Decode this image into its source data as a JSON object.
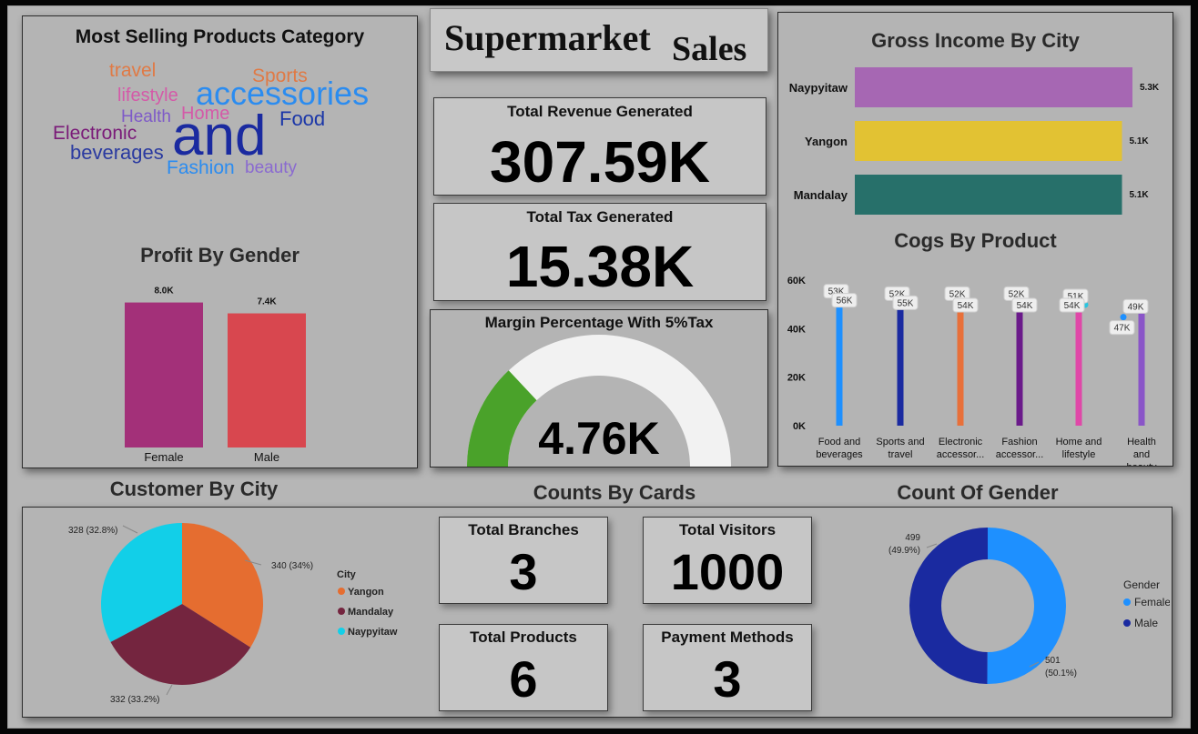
{
  "header": {
    "title_main": "Supermarket",
    "title_sub": "Sales"
  },
  "word_cloud": {
    "title": "Most Selling Products Category",
    "words": [
      {
        "text": "travel",
        "color": "#e07a45"
      },
      {
        "text": "Sports",
        "color": "#e07a45"
      },
      {
        "text": "lifestyle",
        "color": "#d45aa8"
      },
      {
        "text": "accessories",
        "color": "#2b8cf0"
      },
      {
        "text": "Health",
        "color": "#7e5ac8"
      },
      {
        "text": "Home",
        "color": "#d45aa8"
      },
      {
        "text": "Food",
        "color": "#1a36a8"
      },
      {
        "text": "Electronic",
        "color": "#7a1a78"
      },
      {
        "text": "and",
        "color": "#1a2aa0"
      },
      {
        "text": "beverages",
        "color": "#2a3aa0"
      },
      {
        "text": "Fashion",
        "color": "#2b8cf0"
      },
      {
        "text": "beauty",
        "color": "#8a6ad0"
      }
    ]
  },
  "kpis": {
    "revenue": {
      "label": "Total Revenue Generated",
      "value": "307.59K"
    },
    "tax": {
      "label": "Total Tax Generated",
      "value": "15.38K"
    },
    "margin": {
      "label": "Margin Percentage With 5%Tax",
      "value": "4.76K",
      "gauge_fraction": 0.26
    }
  },
  "counts": {
    "title": "Counts By Cards",
    "branches": {
      "label": "Total Branches",
      "value": "3"
    },
    "visitors": {
      "label": "Total Visitors",
      "value": "1000"
    },
    "products": {
      "label": "Total Products",
      "value": "6"
    },
    "payments": {
      "label": "Payment Methods",
      "value": "3"
    }
  },
  "chart_data": [
    {
      "type": "bar",
      "title": "Profit By Gender",
      "categories": [
        "Female",
        "Male"
      ],
      "values": [
        8.0,
        7.4
      ],
      "value_labels": [
        "8.0K",
        "7.4K"
      ],
      "colors": [
        "#a33079",
        "#d8474f"
      ],
      "ylim": [
        0,
        9
      ]
    },
    {
      "type": "bar",
      "title": "Gross Income By City",
      "orientation": "horizontal",
      "categories": [
        "Naypyitaw",
        "Yangon",
        "Mandalay"
      ],
      "values": [
        5.3,
        5.1,
        5.1
      ],
      "value_labels": [
        "5.3K",
        "5.1K",
        "5.1K"
      ],
      "colors": [
        "#a667b3",
        "#e2c233",
        "#27706a"
      ]
    },
    {
      "type": "bar",
      "title": "Cogs By Product",
      "categories": [
        "Food and beverages",
        "Sports and travel",
        "Electronic accessor...",
        "Fashion accessor...",
        "Home and lifestyle",
        "Health and beauty"
      ],
      "category_lines": [
        [
          "Food and",
          "beverages"
        ],
        [
          "Sports and",
          "travel"
        ],
        [
          "Electronic",
          "accessor..."
        ],
        [
          "Fashion",
          "accessor..."
        ],
        [
          "Home and",
          "lifestyle"
        ],
        [
          "Health",
          "and",
          "beauty"
        ]
      ],
      "colors": [
        "#1e90ff",
        "#1a2aa0",
        "#e8703a",
        "#6a1a8a",
        "#e048a8",
        "#8a55c8"
      ],
      "yticks": [
        "0K",
        "20K",
        "40K",
        "60K"
      ],
      "ylim": [
        0,
        60
      ],
      "series": [
        {
          "name": "bar",
          "values": [
            53,
            52,
            52,
            52,
            51,
            47
          ],
          "labels": [
            "53K",
            "52K",
            "52K",
            "52K",
            "51K",
            "47K"
          ]
        },
        {
          "name": "marker",
          "values": [
            56,
            55,
            54,
            54,
            54,
            49
          ],
          "labels": [
            "56K",
            "55K",
            "54K",
            "54K",
            "54K",
            "49K"
          ]
        }
      ]
    },
    {
      "type": "pie",
      "title": "Customer By City",
      "legend_title": "City",
      "labels": [
        "Yangon",
        "Mandalay",
        "Naypyitaw"
      ],
      "values": [
        340,
        332,
        328
      ],
      "slice_labels": [
        "340 (34%)",
        "332 (33.2%)",
        "328 (32.8%)"
      ],
      "colors": [
        "#e56d30",
        "#74253f",
        "#12cfe8"
      ]
    },
    {
      "type": "pie",
      "title": "Count Of Gender",
      "donut": true,
      "legend_title": "Gender",
      "labels": [
        "Female",
        "Male"
      ],
      "values": [
        501,
        499
      ],
      "slice_labels": [
        [
          "501",
          "(50.1%)"
        ],
        [
          "499",
          "(49.9%)"
        ]
      ],
      "colors": [
        "#1e90ff",
        "#1a2aa0"
      ]
    }
  ]
}
